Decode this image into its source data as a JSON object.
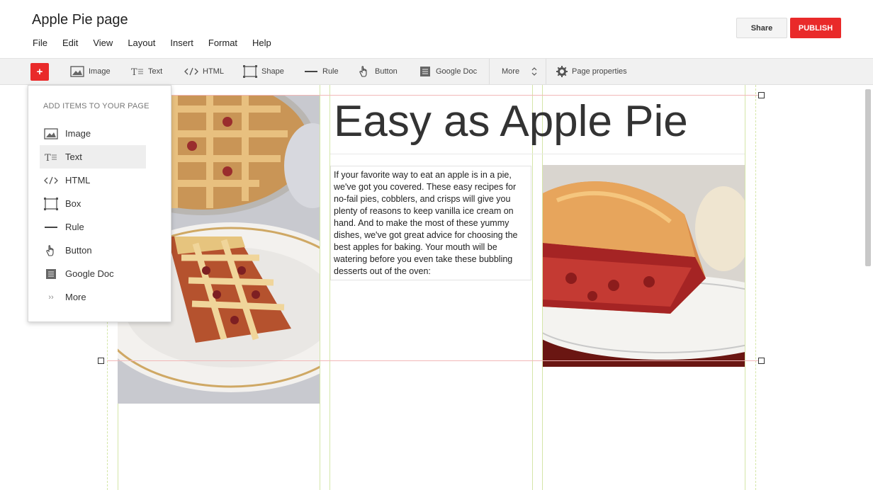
{
  "header": {
    "title": "Apple Pie page",
    "menu": [
      "File",
      "Edit",
      "View",
      "Layout",
      "Insert",
      "Format",
      "Help"
    ],
    "share_label": "Share",
    "publish_label": "PUBLISH"
  },
  "toolbar": {
    "add_label": "+",
    "items": [
      {
        "label": "Image",
        "icon": "image-icon"
      },
      {
        "label": "Text",
        "icon": "text-icon"
      },
      {
        "label": "HTML",
        "icon": "html-icon"
      },
      {
        "label": "Shape",
        "icon": "shape-icon"
      },
      {
        "label": "Rule",
        "icon": "rule-icon"
      },
      {
        "label": "Button",
        "icon": "hand-icon"
      },
      {
        "label": "Google Doc",
        "icon": "doc-icon"
      }
    ],
    "more_label": "More",
    "page_properties_label": "Page properties"
  },
  "add_menu": {
    "title": "ADD ITEMS TO YOUR PAGE",
    "items": [
      {
        "label": "Image",
        "icon": "image-icon"
      },
      {
        "label": "Text",
        "icon": "text-icon",
        "selected": true
      },
      {
        "label": "HTML",
        "icon": "html-icon"
      },
      {
        "label": "Box",
        "icon": "box-icon"
      },
      {
        "label": "Rule",
        "icon": "rule-icon"
      },
      {
        "label": "Button",
        "icon": "hand-icon"
      },
      {
        "label": "Google Doc",
        "icon": "doc-icon"
      },
      {
        "label": "More",
        "icon": "more-icon"
      }
    ]
  },
  "page": {
    "heading": "Easy as Apple Pie",
    "body_text": "If your favorite way to eat an apple is in a pie, we've got you covered. These easy recipes for no-fail pies, cobblers, and crisps will give you plenty of reasons to keep vanilla ice cream on hand. And to make the most of these yummy dishes, we've got great advice for choosing the best apples for baking. Your mouth will be watering before you even take these bubbling desserts out of the oven:"
  },
  "colors": {
    "accent_red": "#e92a2a",
    "guide_green": "#d4e6a8",
    "guide_pink": "#f2b8b8"
  }
}
